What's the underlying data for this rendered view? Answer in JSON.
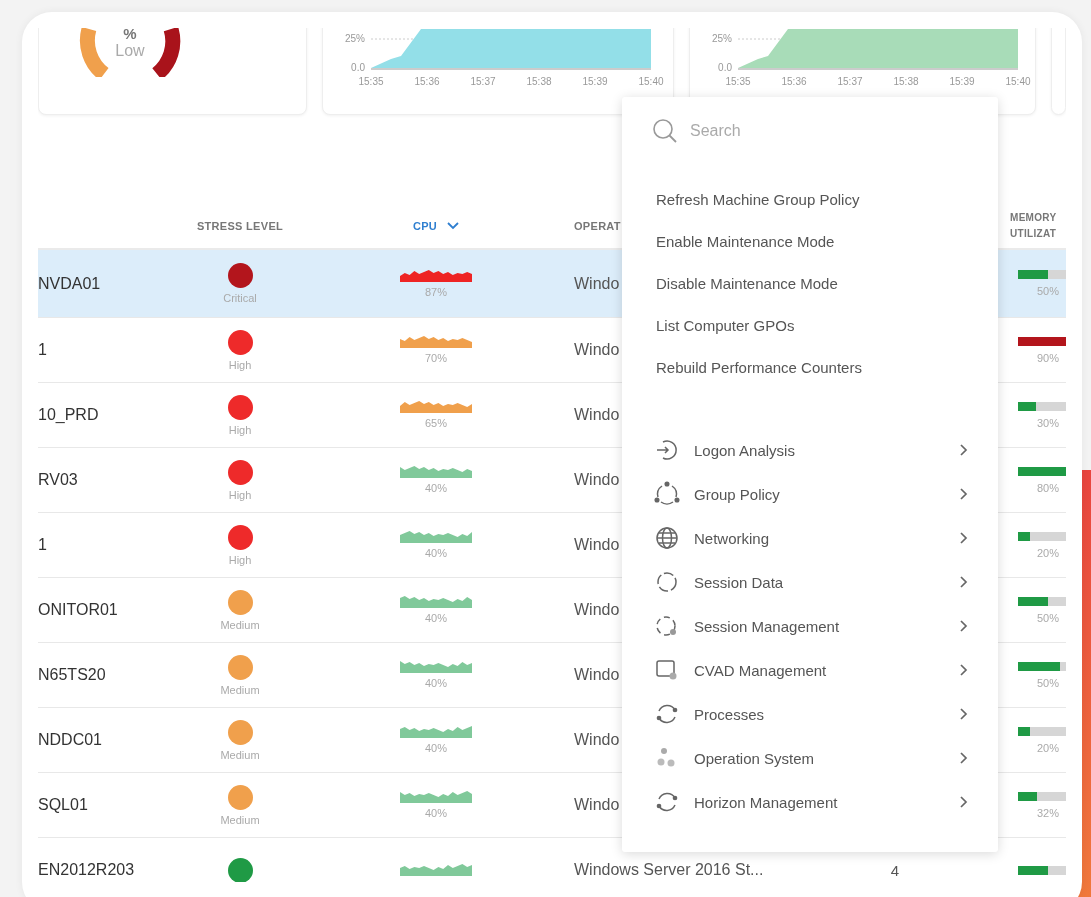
{
  "donut": {
    "value_unit": "%",
    "status": "Low"
  },
  "charts": [
    {
      "y_ticks": [
        "25%",
        "0.0"
      ],
      "x_ticks": [
        "15:35",
        "15:36",
        "15:37",
        "15:38",
        "15:39",
        "15:40"
      ],
      "color": "#93dfe8"
    },
    {
      "y_ticks": [
        "25%",
        "0.0"
      ],
      "x_ticks": [
        "15:35",
        "15:36",
        "15:37",
        "15:38",
        "15:39",
        "15:40"
      ],
      "color": "#a8dcb8"
    }
  ],
  "table": {
    "columns": {
      "stress": "STRESS LEVEL",
      "cpu": "CPU",
      "os": "OPERAT",
      "memory": [
        "MEMORY",
        "UTILIZAT"
      ]
    },
    "rows": [
      {
        "name": "NVDA01",
        "selected": true,
        "stress": {
          "label": "Critical",
          "color": "#b3151c"
        },
        "cpu": {
          "label": "87%",
          "color": "#ee2424"
        },
        "os": "Windo",
        "memory": {
          "level": 0.5,
          "label": "50%",
          "color": "#1f9a45"
        }
      },
      {
        "name": "1",
        "selected": false,
        "stress": {
          "label": "High",
          "color": "#ee2a2a"
        },
        "cpu": {
          "label": "70%",
          "color": "#f0a04c"
        },
        "os": "Windo",
        "memory": {
          "level": 0.9,
          "label": "90%",
          "color": "#b3151c"
        }
      },
      {
        "name": "10_PRD",
        "selected": false,
        "stress": {
          "label": "High",
          "color": "#ee2a2a"
        },
        "cpu": {
          "label": "65%",
          "color": "#f0a04c"
        },
        "os": "Windo",
        "memory": {
          "level": 0.3,
          "label": "30%",
          "color": "#1f9a45"
        }
      },
      {
        "name": "RV03",
        "selected": false,
        "stress": {
          "label": "High",
          "color": "#ee2a2a"
        },
        "cpu": {
          "label": "40%",
          "color": "#80c99a"
        },
        "os": "Windo",
        "memory": {
          "level": 0.8,
          "label": "80%",
          "color": "#1f9a45"
        }
      },
      {
        "name": "1",
        "selected": false,
        "stress": {
          "label": "High",
          "color": "#ee2a2a"
        },
        "cpu": {
          "label": "40%",
          "color": "#80c99a"
        },
        "os": "Windo",
        "memory": {
          "level": 0.2,
          "label": "20%",
          "color": "#1f9a45"
        }
      },
      {
        "name": "ONITOR01",
        "selected": false,
        "stress": {
          "label": "Medium",
          "color": "#f0a04c"
        },
        "cpu": {
          "label": "40%",
          "color": "#80c99a"
        },
        "os": "Windo",
        "memory": {
          "level": 0.5,
          "label": "50%",
          "color": "#1f9a45"
        }
      },
      {
        "name": "N65TS20",
        "selected": false,
        "stress": {
          "label": "Medium",
          "color": "#f0a04c"
        },
        "cpu": {
          "label": "40%",
          "color": "#80c99a"
        },
        "os": "Windo",
        "memory": {
          "level": 0.7,
          "label": "50%",
          "color": "#1f9a45"
        }
      },
      {
        "name": "NDDC01",
        "selected": false,
        "stress": {
          "label": "Medium",
          "color": "#f0a04c"
        },
        "cpu": {
          "label": "40%",
          "color": "#80c99a"
        },
        "os": "Windo",
        "memory": {
          "level": 0.2,
          "label": "20%",
          "color": "#1f9a45"
        }
      },
      {
        "name": "SQL01",
        "selected": false,
        "stress": {
          "label": "Medium",
          "color": "#f0a04c"
        },
        "cpu": {
          "label": "40%",
          "color": "#80c99a"
        },
        "os": "Windo",
        "memory": {
          "level": 0.32,
          "label": "32%",
          "color": "#1f9a45"
        }
      },
      {
        "name": "EN2012R203",
        "selected": false,
        "stress": {
          "color": "#1f9a45"
        },
        "cpu": {
          "color": "#80c99a"
        },
        "os": "Windows Server 2016 St...",
        "count": "4",
        "memory": {
          "level": 0.5,
          "color": "#1f9a45"
        }
      }
    ]
  },
  "menu": {
    "search": {
      "placeholder": "Search"
    },
    "actions": [
      "Refresh Machine Group Policy",
      "Enable Maintenance Mode",
      "Disable Maintenance Mode",
      "List Computer GPOs",
      "Rebuild Performance Counters"
    ],
    "submenus": [
      {
        "label": "Logon Analysis",
        "kind": "enter"
      },
      {
        "label": "Group Policy",
        "kind": "cycle"
      },
      {
        "label": "Networking",
        "kind": "globe"
      },
      {
        "label": "Session Data",
        "kind": "dashed"
      },
      {
        "label": "Session Management",
        "kind": "dashed-gear"
      },
      {
        "label": "CVAD Management",
        "kind": "monitor"
      },
      {
        "label": "Processes",
        "kind": "refresh"
      },
      {
        "label": "Operation System",
        "kind": "people"
      },
      {
        "label": "Horizon Management",
        "kind": "refresh"
      }
    ]
  }
}
